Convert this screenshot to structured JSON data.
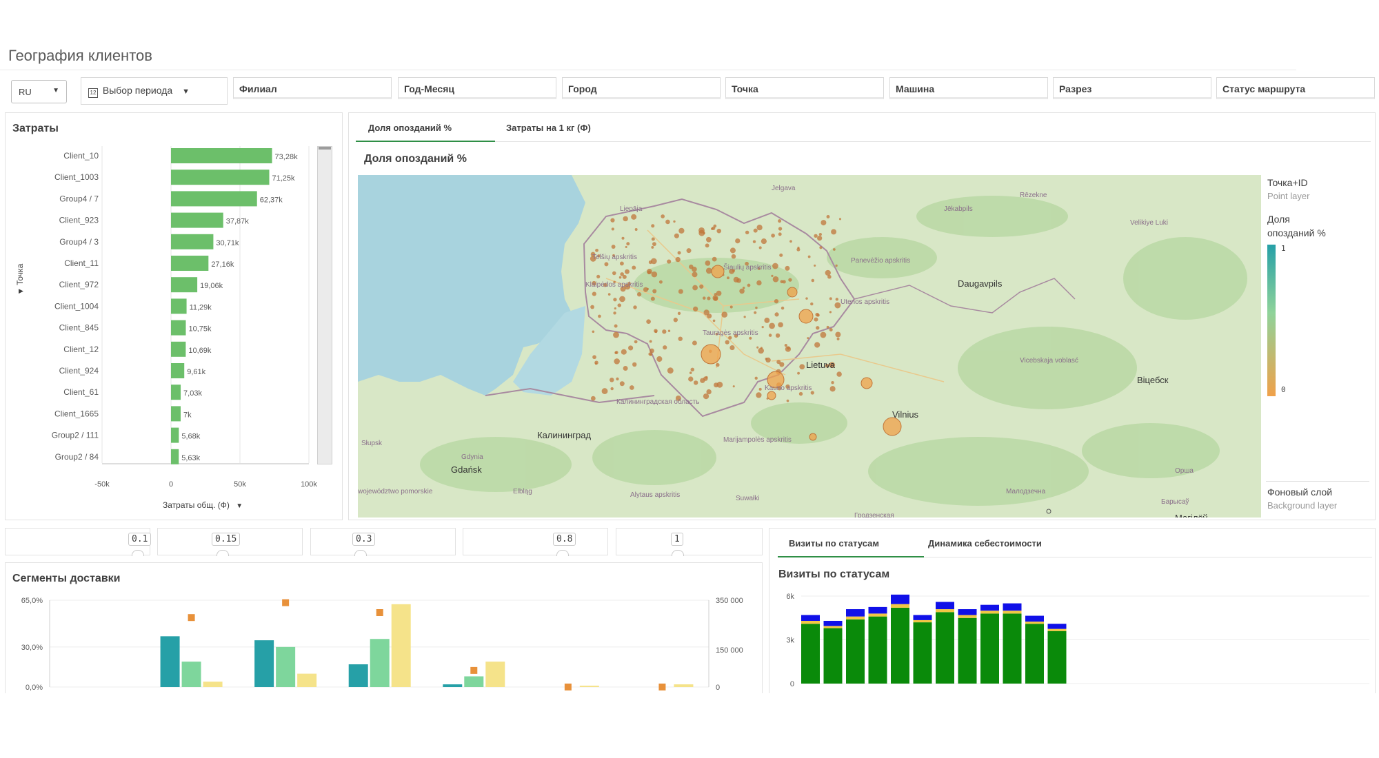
{
  "page": {
    "title": "География клиентов"
  },
  "toolbar": {
    "language": "RU",
    "period_label": "Выбор периода",
    "filters": [
      "Филиал",
      "Год-Месяц",
      "Город",
      "Точка",
      "Машина",
      "Разрез",
      "Статус маршрута"
    ]
  },
  "costs_panel": {
    "title": "Затраты",
    "dimension_label": "Точка",
    "measure_label": "Затраты общ. (Ф)",
    "bar_color": "#6cbf6a"
  },
  "map_panel": {
    "tabs": [
      "Доля опозданий %",
      "Затраты на 1 кг (Ф)"
    ],
    "title": "Доля опозданий %",
    "legend": {
      "point_layer_title": "Точка+ID",
      "point_layer_sub": "Point layer",
      "metric": "Доля опозданий %",
      "max": "1",
      "min": "0",
      "background_title": "Фоновый слой",
      "background_sub": "Background layer"
    },
    "places": [
      "Jelgava",
      "Rēzekne",
      "Liepāja",
      "Jēkabpils",
      "Velikiye Luki",
      "Telšių apskritis",
      "Šiaulių apskritis",
      "Panevėžio apskritis",
      "Daugavpils",
      "Klaipėdos apskritis",
      "Utenos apskritis",
      "Tauragės apskritis",
      "Lietuva",
      "Vicebskaja voblasć",
      "Kauno apskritis",
      "Vilnius",
      "Віцебск",
      "Калининградская область",
      "Калининград",
      "Marijampolės apskritis",
      "Słupsk",
      "Gdynia",
      "Gdańsk",
      "Alytaus apskritis",
      "Орша",
      "Elbląg",
      "województwo pomorskie",
      "Suwałki",
      "Малодзечна",
      "Барысаў",
      "Гродзенская",
      "Магілёў"
    ]
  },
  "sliders": [
    "0.1",
    "0.15",
    "0.3",
    "0.8",
    "1"
  ],
  "segments_panel": {
    "title": "Сегменты доставки",
    "left_axis": [
      "65,0%",
      "30,0%",
      "0,0%"
    ],
    "right_axis": [
      "350 000",
      "150 000",
      "0"
    ]
  },
  "visits_panel": {
    "tabs": [
      "Визиты по статусам",
      "Динамика себестоимости"
    ],
    "title": "Визиты по статусам",
    "y_axis": [
      "6k",
      "3k",
      "0"
    ]
  },
  "chart_data": [
    {
      "type": "bar",
      "orientation": "horizontal",
      "title": "Затраты",
      "xlabel": "Затраты общ. (Ф)",
      "ylabel": "Точка",
      "xlim": [
        -50000,
        100000
      ],
      "x_ticks": [
        "-50k",
        "0",
        "50k",
        "100k"
      ],
      "categories": [
        "Client_10",
        "Client_1003",
        "Group4 / 7",
        "Client_923",
        "Group4 / 3",
        "Client_11",
        "Client_972",
        "Client_1004",
        "Client_845",
        "Client_12",
        "Client_924",
        "Client_61",
        "Client_1665",
        "Group2 / 111",
        "Group2 / 84"
      ],
      "values": [
        73280,
        71250,
        62370,
        37870,
        30710,
        27160,
        19060,
        11290,
        10750,
        10690,
        9610,
        7030,
        7000,
        5680,
        5630
      ],
      "labels": [
        "73,28k",
        "71,25k",
        "62,37k",
        "37,87k",
        "30,71k",
        "27,16k",
        "19,06k",
        "11,29k",
        "10,75k",
        "10,69k",
        "9,61k",
        "7,03k",
        "7k",
        "5,68k",
        "5,63k"
      ]
    },
    {
      "type": "bar",
      "title": "Сегменты доставки",
      "ylim_left": [
        0,
        0.65
      ],
      "ylim_right": [
        0,
        350000
      ],
      "groups": 7,
      "series": [
        {
          "color": "#26a0a7",
          "values": [
            0,
            0.38,
            0.35,
            0.17,
            0.02,
            0,
            0
          ]
        },
        {
          "color": "#7ed69c",
          "values": [
            0,
            0.19,
            0.3,
            0.36,
            0.08,
            0,
            0
          ]
        },
        {
          "color": "#f5e38a",
          "values": [
            0,
            0.04,
            0.1,
            0.62,
            0.19,
            0.01,
            0.02
          ]
        }
      ],
      "markers": {
        "color": "#e8913a",
        "values": [
          null,
          280000,
          340000,
          300000,
          67000,
          0,
          0
        ]
      }
    },
    {
      "type": "bar",
      "stacked": true,
      "title": "Визиты по статусам",
      "ylim": [
        0,
        6000
      ],
      "y_ticks": [
        "6k",
        "3k",
        "0"
      ],
      "series": [
        {
          "color": "#0a8a0a",
          "values": [
            4100,
            3800,
            4400,
            4600,
            5200,
            4200,
            4900,
            4500,
            4800,
            4800,
            4100,
            3600
          ]
        },
        {
          "color": "#f2c744",
          "values": [
            200,
            150,
            200,
            200,
            250,
            150,
            200,
            200,
            200,
            200,
            150,
            150
          ]
        },
        {
          "color": "#1010e8",
          "values": [
            400,
            350,
            500,
            450,
            650,
            350,
            500,
            400,
            400,
            500,
            400,
            350
          ]
        }
      ]
    }
  ]
}
